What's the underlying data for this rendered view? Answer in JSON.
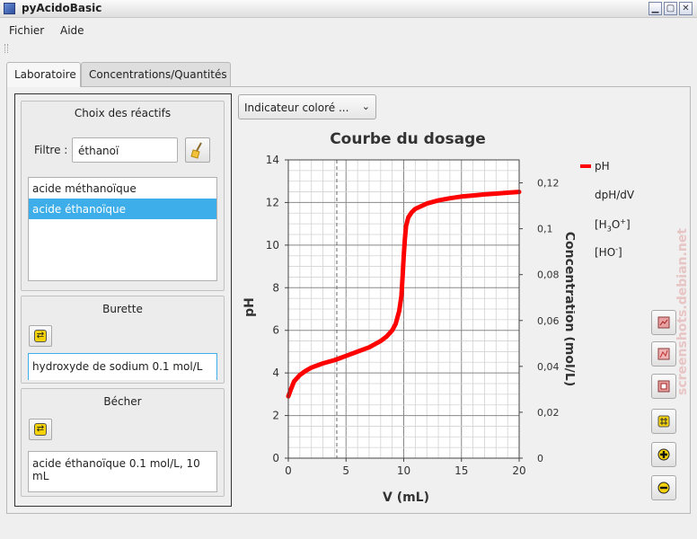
{
  "window": {
    "title": "pyAcidoBasic"
  },
  "menu": {
    "items": [
      "Fichier",
      "Aide"
    ]
  },
  "tabs": [
    "Laboratoire",
    "Concentrations/Quantités"
  ],
  "reactifs": {
    "title": "Choix des réactifs",
    "filter_label": "Filtre :",
    "filter_value": "éthanoï",
    "list": [
      "acide méthanoïque",
      "acide éthanoïque"
    ],
    "selected_index": 1
  },
  "burette": {
    "title": "Burette",
    "value": "hydroxyde de sodium 0.1 mol/L"
  },
  "becher": {
    "title": "Bécher",
    "value": "acide éthanoïque 0.1 mol/L, 10 mL"
  },
  "indicator": {
    "label": "Indicateur coloré ..."
  },
  "legend": {
    "ph": "pH",
    "dphdv": "dpH/dV",
    "h3o_base": "[H",
    "h3o_sub": "3",
    "h3o_mid": "O",
    "h3o_sup": "+",
    "h3o_end": "]",
    "ho_base": "[HO",
    "ho_sup": "-",
    "ho_end": "]"
  },
  "watermark": "screenshots.debian.net",
  "chart_data": {
    "type": "line",
    "title": "Courbe du dosage",
    "xlabel": "V (mL)",
    "ylabel": "pH",
    "y2label": "Concentration (mol/L)",
    "xlim": [
      0,
      20
    ],
    "ylim": [
      0,
      14
    ],
    "y2lim": [
      0,
      0.13
    ],
    "xticks": [
      0,
      5,
      10,
      15,
      20
    ],
    "yticks": [
      0,
      2,
      4,
      6,
      8,
      10,
      12,
      14
    ],
    "y2ticks": [
      "0",
      "0,02",
      "0,04",
      "0,06",
      "0,08",
      "0,1",
      "0,12"
    ],
    "y2tick_values": [
      0,
      0.02,
      0.04,
      0.06,
      0.08,
      0.1,
      0.12
    ],
    "grid": true,
    "vline_x": 4.2,
    "series": [
      {
        "name": "pH",
        "color": "#ff0000",
        "x": [
          0,
          0.2,
          0.5,
          1,
          1.5,
          2,
          3,
          4,
          5,
          6,
          7,
          8,
          8.5,
          9,
          9.3,
          9.6,
          9.8,
          9.9,
          10,
          10.1,
          10.2,
          10.4,
          10.7,
          11,
          12,
          13,
          14,
          15,
          16,
          17,
          18,
          19,
          20
        ],
        "y": [
          2.9,
          3.2,
          3.6,
          3.9,
          4.1,
          4.25,
          4.45,
          4.6,
          4.8,
          5.0,
          5.2,
          5.5,
          5.7,
          6.0,
          6.3,
          6.9,
          7.6,
          8.5,
          9.5,
          10.3,
          10.9,
          11.3,
          11.55,
          11.7,
          11.95,
          12.1,
          12.2,
          12.28,
          12.33,
          12.38,
          12.42,
          12.46,
          12.5
        ]
      }
    ]
  }
}
